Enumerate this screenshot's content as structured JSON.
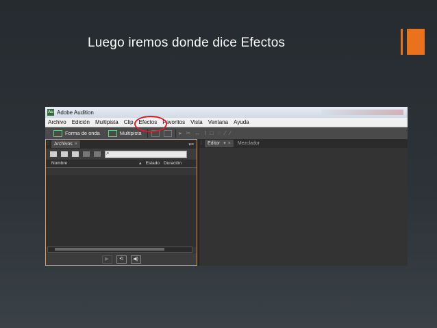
{
  "slide": {
    "title": "Luego iremos donde dice Efectos",
    "accent_color": "#e8731c"
  },
  "window": {
    "app_icon_text": "Au",
    "title": "Adobe Audition"
  },
  "menu": {
    "items": [
      "Archivo",
      "Edición",
      "Multipista",
      "Clip",
      "Efectos",
      "Favoritos",
      "Vista",
      "Ventana",
      "Ayuda"
    ],
    "highlighted": "Efectos",
    "highlight_color": "#d8202a"
  },
  "toolbar": {
    "waveform_label": "Forma de onda",
    "multitrack_label": "Multipista"
  },
  "files_panel": {
    "tab": "Archivos",
    "columns": {
      "name": "Nombre",
      "status": "Estado",
      "duration": "Duración"
    }
  },
  "editor_panel": {
    "tabs": [
      "Editor",
      "Mezclador"
    ]
  },
  "icons": {
    "grip": "⁞",
    "close": "×",
    "panel_menu": "▾≡",
    "dropdown": "▾",
    "sort_up": "▲",
    "search": "⌕",
    "play": "▶",
    "loop": "⟲",
    "speaker": "◀)"
  }
}
